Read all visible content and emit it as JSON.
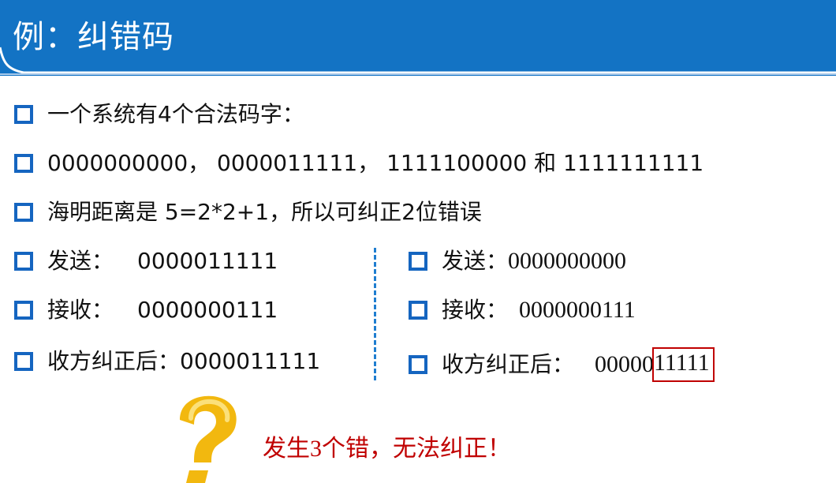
{
  "title": "例：纠错码",
  "lines": [
    "一个系统有4个合法码字：",
    "0000000000，  0000011111，  1111100000  和  1111111111",
    "海明距离是  5=2*2+1，所以可纠正2位错误"
  ],
  "left": {
    "send_label": "发送：",
    "send_value": "0000011111",
    "recv_label": "接收：",
    "recv_value": "0000000111",
    "fix_label": "收方纠正后：",
    "fix_value": "0000011111"
  },
  "right": {
    "send_label": "发送：",
    "send_value": "0000000000",
    "recv_label": "接收：",
    "recv_value": "0000000111",
    "fix_label": "收方纠正后：",
    "fix_value_plain": "00000",
    "fix_value_boxed": "11111"
  },
  "conclusion": "发生3个错，无法纠正！",
  "colors": {
    "header": "#1373c4",
    "bullet": "#1565c0",
    "highlight": "#c00000",
    "question_mark": "#f2b80f"
  },
  "icons": {
    "bullet": "hollow-square-bullet-icon",
    "question": "question-mark-icon"
  }
}
